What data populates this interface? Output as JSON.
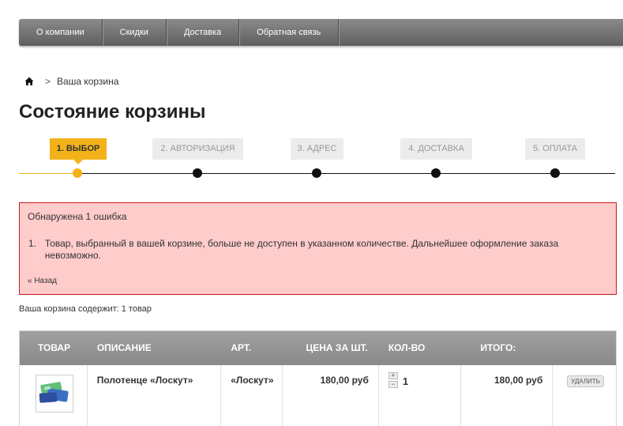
{
  "nav": {
    "items": [
      "О компании",
      "Скидки",
      "Доставка",
      "Обратная связь"
    ]
  },
  "breadcrumb": {
    "separator": ">",
    "current": "Ваша корзина"
  },
  "page_title": "Состояние корзины",
  "steps": [
    {
      "label": "1. ВЫБОР",
      "active": true
    },
    {
      "label": "2. АВТОРИЗАЦИЯ",
      "active": false
    },
    {
      "label": "3. АДРЕС",
      "active": false
    },
    {
      "label": "4. ДОСТАВКА",
      "active": false
    },
    {
      "label": "5. ОПЛАТА",
      "active": false
    }
  ],
  "error": {
    "title": "Обнаружена 1 ошибка",
    "items": [
      {
        "num": "1.",
        "text": "Товар, выбранный в вашей корзине, больше не доступен в указанном количестве. Дальнейшее оформление заказа невозможно."
      }
    ],
    "back_link": "« Назад"
  },
  "cart_count": "Ваша корзина содержит: 1 товар",
  "table": {
    "headers": [
      "ТОВАР",
      "ОПИСАНИЕ",
      "АРТ.",
      "ЦЕНА ЗА ШТ.",
      "КОЛ-ВО",
      "ИТОГО:"
    ],
    "rows": [
      {
        "description": "Полотенце «Лоскут»",
        "article": "«Лоскут»",
        "price": "180,00 руб",
        "qty_plus": "+",
        "qty_minus": "−",
        "quantity": "1",
        "total": "180,00 руб",
        "delete_label": "УДАЛИТЬ"
      }
    ]
  },
  "colors": {
    "accent": "#f3b21a",
    "error_bg": "#fecccb",
    "error_border": "#c21b1b"
  },
  "icons": {
    "home": "home-icon",
    "product_image": "towel-product-thumbnail"
  }
}
